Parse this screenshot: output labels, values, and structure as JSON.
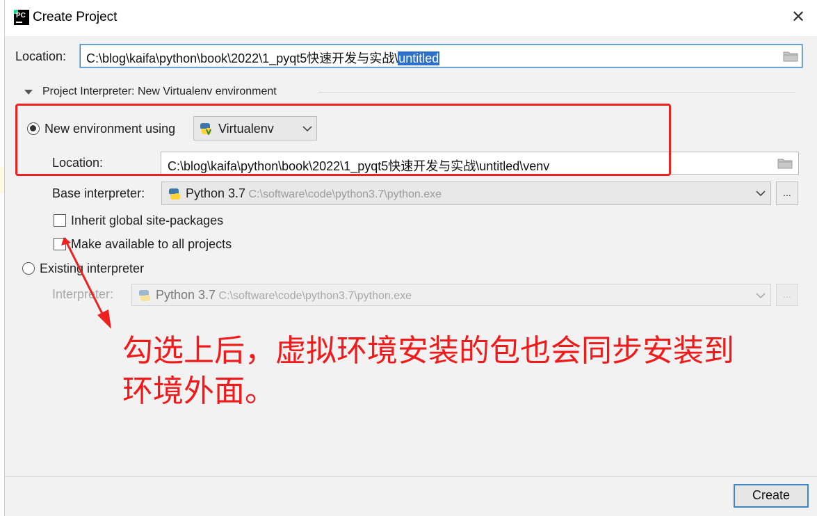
{
  "dialog": {
    "title": "Create Project",
    "close_glyph": "✕"
  },
  "location": {
    "label": "Location:",
    "value_prefix": "C:\\blog\\kaifa\\python\\book\\2022\\1_pyqt5快速开发与实战\\",
    "value_selected": "untitled"
  },
  "interpreter_section": {
    "title": "Project Interpreter: New Virtualenv environment",
    "new_env": {
      "label": "New environment using",
      "selected": true,
      "tool": "Virtualenv"
    },
    "env_location": {
      "label": "Location:",
      "value": "C:\\blog\\kaifa\\python\\book\\2022\\1_pyqt5快速开发与实战\\untitled\\venv"
    },
    "base_interpreter": {
      "label": "Base interpreter:",
      "name": "Python 3.7",
      "path": "C:\\software\\code\\python3.7\\python.exe",
      "browse_label": "..."
    },
    "inherit_packages": {
      "label": "Inherit global site-packages",
      "checked": false
    },
    "make_available": {
      "label": "Make available to all projects",
      "checked": false
    },
    "existing": {
      "label": "Existing interpreter",
      "selected": false,
      "interpreter_label": "Interpreter:",
      "name": "Python 3.7",
      "path": "C:\\software\\code\\python3.7\\python.exe",
      "browse_label": "..."
    }
  },
  "annotation": {
    "text_line1": "勾选上后，虚拟环境安装的包也会同步安装到",
    "text_line2": "环境外面。",
    "color": "#f01a1a"
  },
  "footer": {
    "create_label": "Create"
  },
  "icons": [
    "pycharm-logo-icon",
    "close-icon",
    "folder-icon",
    "collapse-triangle-icon",
    "python-icon",
    "chevron-down-icon"
  ]
}
